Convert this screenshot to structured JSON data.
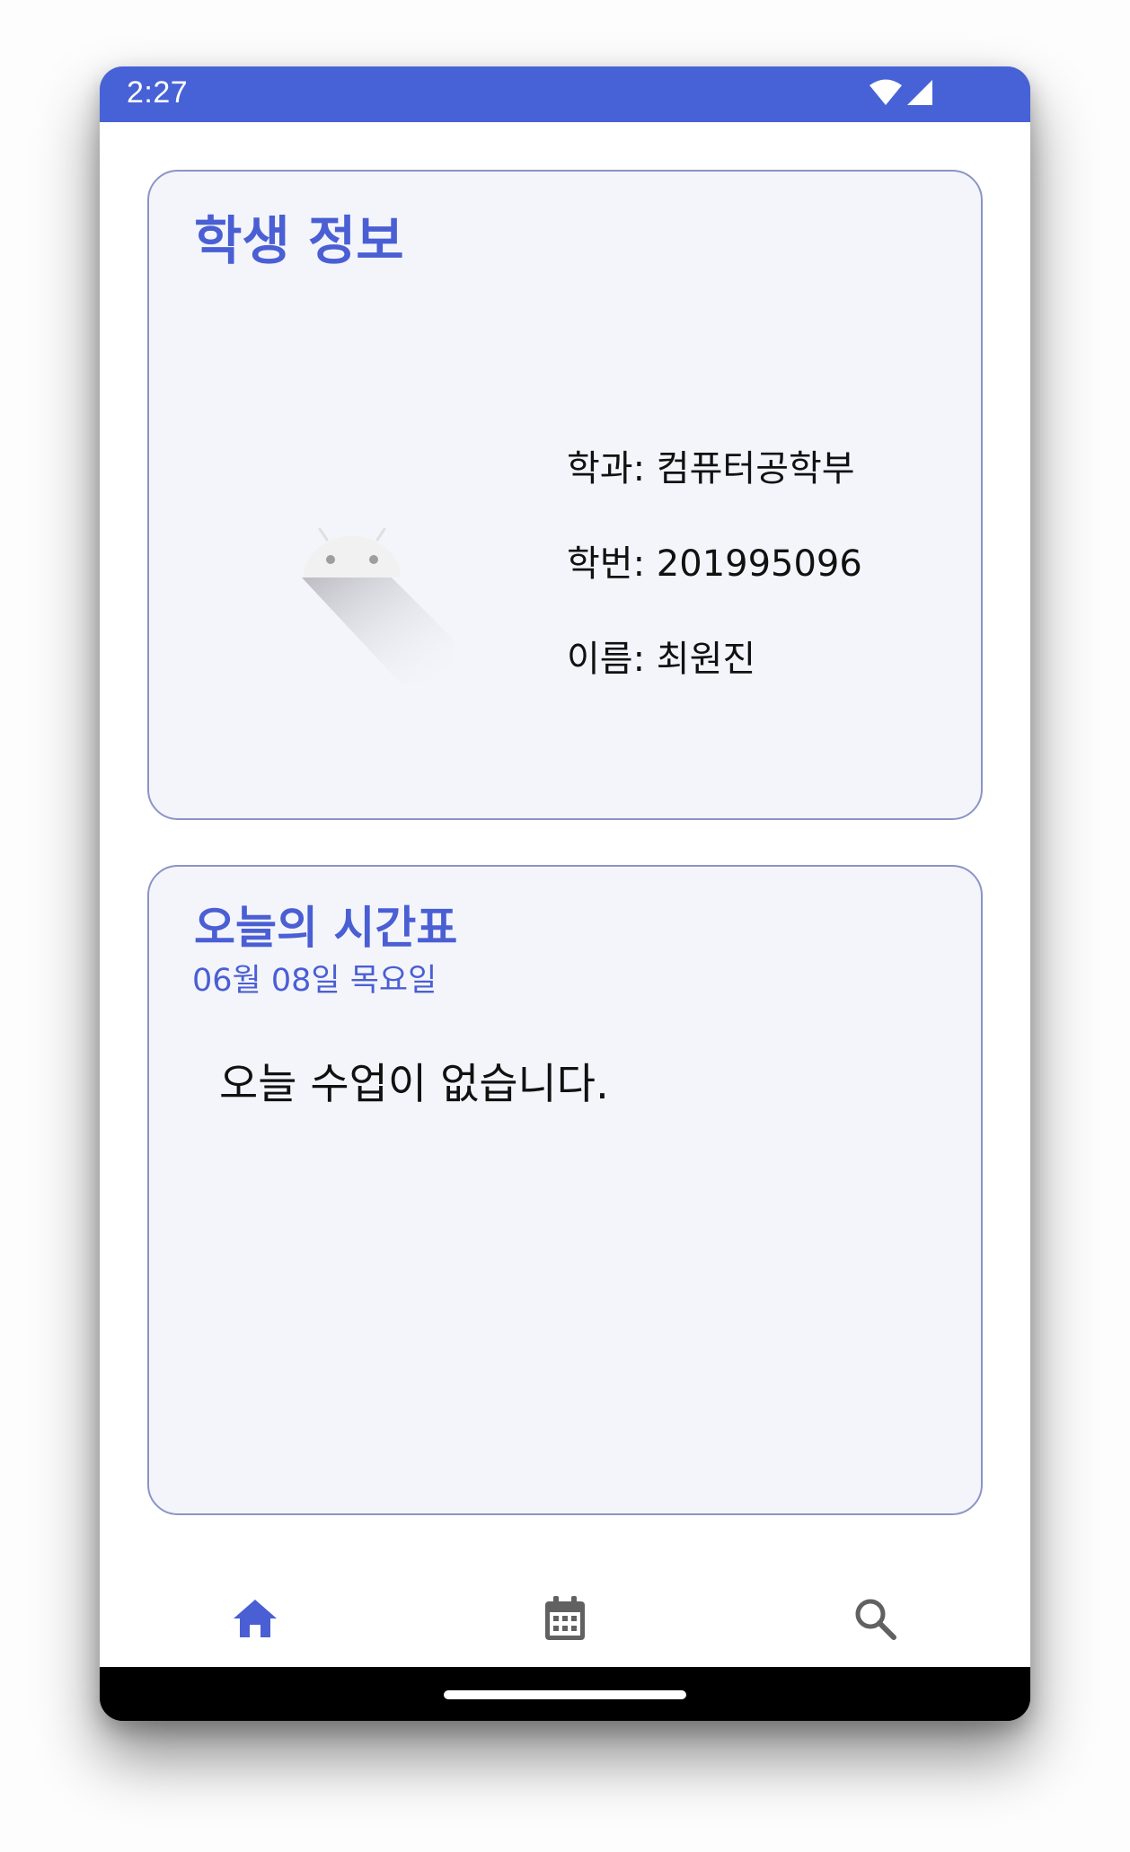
{
  "status_bar": {
    "time": "2:27",
    "color": "#4762d6",
    "icons": [
      "wifi-icon",
      "signal-icon"
    ]
  },
  "student_card": {
    "title": "학생 정보",
    "avatar_icon": "android-icon",
    "department": "학과: 컴퓨터공학부",
    "student_id": "학번: 201995096",
    "name": "이름: 최원진"
  },
  "timetable_card": {
    "title": "오늘의 시간표",
    "date": "06월 08일 목요일",
    "empty_message": "오늘 수업이 없습니다."
  },
  "bottom_nav": {
    "items": [
      {
        "icon": "home-icon",
        "active": true
      },
      {
        "icon": "calendar-icon",
        "active": false
      },
      {
        "icon": "search-icon",
        "active": false
      }
    ],
    "active_color": "#4a5fd4",
    "inactive_color": "#616161"
  },
  "theme": {
    "accent": "#4a5fd4",
    "card_background": "#f4f5fb",
    "card_border": "#8c94c6"
  }
}
